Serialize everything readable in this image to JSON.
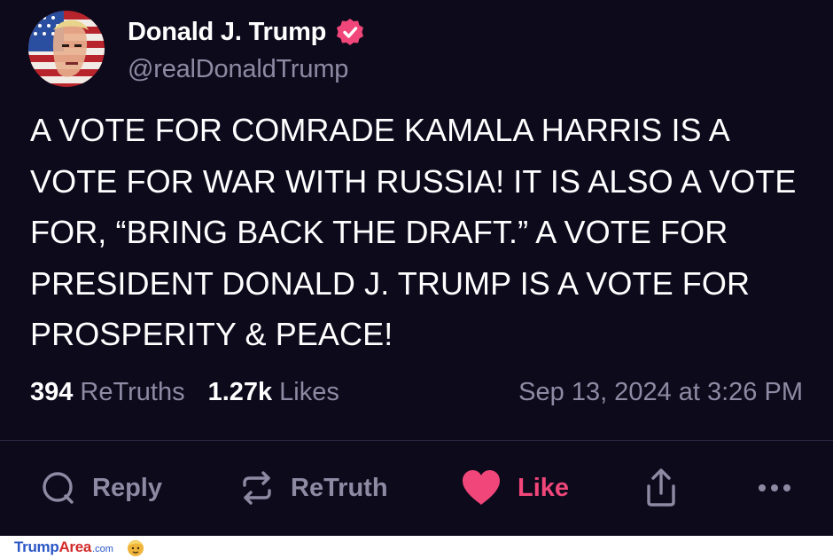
{
  "author": {
    "display_name": "Donald J. Trump",
    "handle": "@realDonaldTrump",
    "verified_icon": "verified-badge-icon",
    "avatar": "flag-portrait-avatar"
  },
  "post": {
    "text": "A VOTE FOR COMRADE KAMALA HARRIS IS A\nVOTE FOR WAR WITH RUSSIA! IT IS ALSO A VOTE\nFOR, “BRING BACK THE DRAFT.” A VOTE FOR\nPRESIDENT DONALD J. TRUMP IS A VOTE FOR\nPROSPERITY & PEACE!"
  },
  "stats": {
    "retruths_count": "394",
    "retruths_label": "ReTruths",
    "likes_count": "1.27k",
    "likes_label": "Likes",
    "timestamp": "Sep 13, 2024 at 3:26 PM"
  },
  "actions": {
    "reply_label": "Reply",
    "retruth_label": "ReTruth",
    "like_label": "Like",
    "share_icon": "share-icon",
    "more_icon": "more-icon"
  },
  "footer": {
    "brand_part1": "Trump",
    "brand_part2": "Area",
    "brand_part3": ".com"
  },
  "colors": {
    "background": "#0d0a1c",
    "muted_text": "#8e8aa3",
    "like_accent": "#f1467a",
    "verified": "#f1467a"
  }
}
